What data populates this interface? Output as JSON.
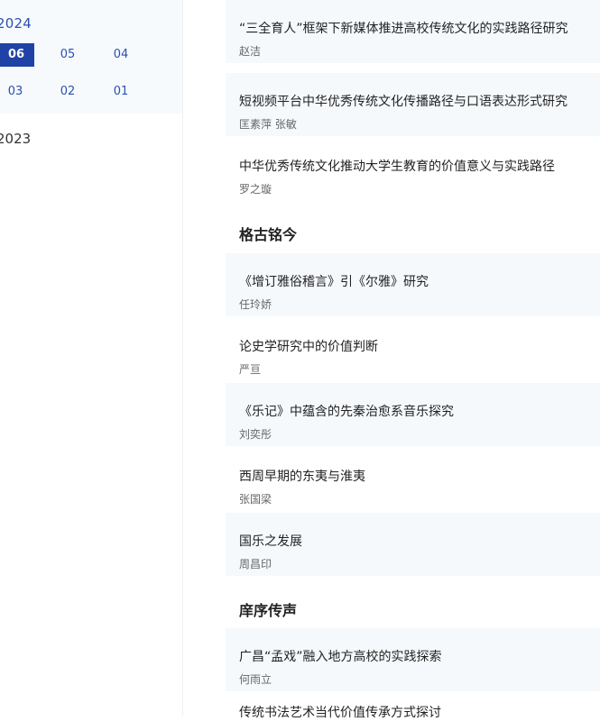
{
  "sidebar": {
    "year_2024": "2024",
    "issues": [
      "06",
      "05",
      "04",
      "03",
      "02",
      "01"
    ],
    "active_issue": "06",
    "year_2023": "2023"
  },
  "sections": [
    {
      "title": "",
      "articles": [
        {
          "title": "“三全育人”框架下新媒体推进高校传统文化的实践路径研究",
          "authors": "赵洁"
        },
        {
          "title": "短视频平台中华优秀传统文化传播路径与口语表达形式研究",
          "authors": "匡素萍 张敏"
        },
        {
          "title": "中华优秀传统文化推动大学生教育的价值意义与实践路径",
          "authors": "罗之璇"
        }
      ]
    },
    {
      "title": "格古铭今",
      "articles": [
        {
          "title": "《增订雅俗稽言》引《尔雅》研究",
          "authors": "任玲娇"
        },
        {
          "title": "论史学研究中的价值判断",
          "authors": "严亘"
        },
        {
          "title": "《乐记》中蕴含的先秦治愈系音乐探究",
          "authors": "刘奕彤"
        },
        {
          "title": "西周早期的东夷与淮夷",
          "authors": "张国梁"
        },
        {
          "title": "国乐之发展",
          "authors": "周昌印"
        }
      ]
    },
    {
      "title": "庠序传声",
      "articles": [
        {
          "title": "广昌“孟戏”融入地方高校的实践探索",
          "authors": "何雨立"
        },
        {
          "title": "传统书法艺术当代价值传承方式探讨",
          "authors": ""
        }
      ]
    }
  ],
  "colors": {
    "accent": "#1e42a6",
    "link": "#2b50b0",
    "row_shade": "#f6f9fc"
  }
}
